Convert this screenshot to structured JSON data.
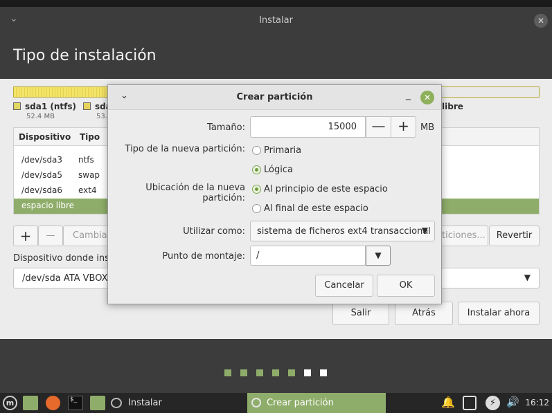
{
  "window": {
    "title": "Instalar",
    "heading": "Tipo de instalación"
  },
  "partition_bar": {
    "legend": [
      {
        "name": "sda1 (ntfs)",
        "size": "52.4 MB",
        "color": "#e0d860"
      },
      {
        "name": "sda",
        "size": "53.",
        "color": "#e8d35a"
      },
      {
        "name": "libre",
        "size": "",
        "color": "#ffffff"
      }
    ]
  },
  "table": {
    "headers": [
      "Dispositivo",
      "Tipo"
    ],
    "rows": [
      {
        "device": "/dev/sda3",
        "type": "ntfs",
        "selected": false
      },
      {
        "device": "/dev/sda5",
        "type": "swap",
        "selected": false
      },
      {
        "device": "/dev/sda6",
        "type": "ext4",
        "selected": false
      },
      {
        "device": "espacio libre",
        "type": "",
        "selected": true
      }
    ]
  },
  "toolbar": {
    "add": "+",
    "remove": "—",
    "change": "Cambiar...",
    "new_table": "ticiones...",
    "revert": "Revertir"
  },
  "bootloader": {
    "label": "Dispositivo donde insta",
    "value": "/dev/sda   ATA VBOX"
  },
  "nav": {
    "quit": "Salir",
    "back": "Atrás",
    "install": "Instalar ahora"
  },
  "progress_dots": {
    "total": 7,
    "current": 6
  },
  "dialog": {
    "title": "Crear partición",
    "size_label": "Tamaño:",
    "size_value": "15000",
    "size_unit": "MB",
    "decrement": "—",
    "increment": "+",
    "type_label": "Tipo de la nueva partición:",
    "type_options": [
      "Primaria",
      "Lógica"
    ],
    "type_selected": "Lógica",
    "location_label": "Ubicación de la nueva partición:",
    "location_options": [
      "Al principio de este espacio",
      "Al final de este espacio"
    ],
    "location_selected": "Al principio de este espacio",
    "use_label": "Utilizar como:",
    "use_value": "sistema de ficheros ext4 transaccional",
    "mount_label": "Punto de montaje:",
    "mount_value": "/",
    "cancel": "Cancelar",
    "ok": "OK"
  },
  "taskbar": {
    "app_label": "Instalar",
    "active_label": "Crear partición",
    "clock": "16:12"
  }
}
